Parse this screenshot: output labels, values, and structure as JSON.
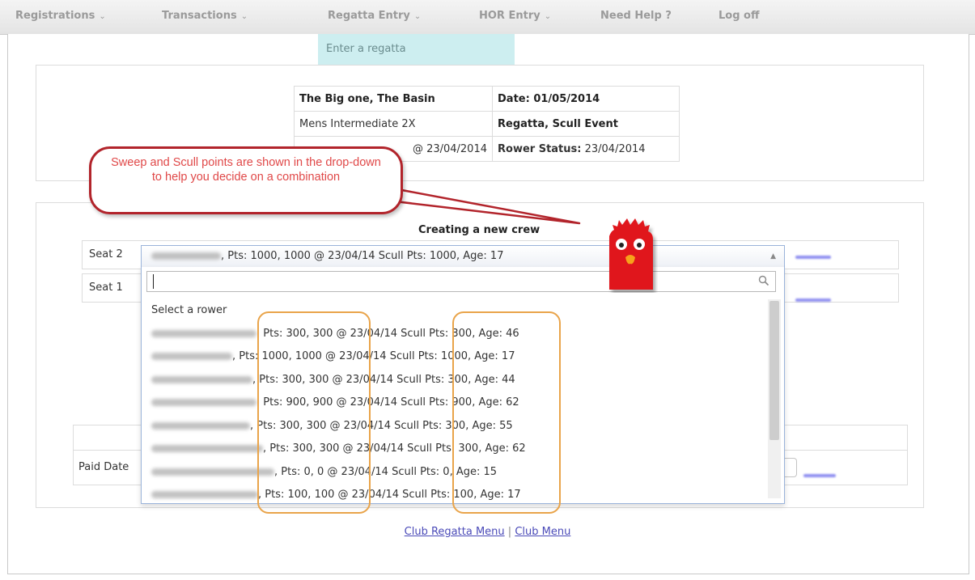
{
  "menu": {
    "items": [
      {
        "label": "Registrations",
        "caret": "⌄"
      },
      {
        "label": "Transactions",
        "caret": "⌄"
      },
      {
        "label": "Regatta Entry",
        "caret": "⌄"
      },
      {
        "label": "HOR Entry",
        "caret": "⌄"
      },
      {
        "label": "Need Help ?",
        "caret": ""
      },
      {
        "label": "Log off",
        "caret": ""
      }
    ],
    "open_submenu_item": "Enter a regatta"
  },
  "event": {
    "name": "The Big one, The Basin",
    "date": "Date: 01/05/2014",
    "category": "Mens Intermediate 2X",
    "type": "Regatta, Scull Event",
    "points_date": "@ 23/04/2014",
    "rower_status_label": "Rower Status:",
    "rower_status_value": " 23/04/2014"
  },
  "callout": {
    "text": "Sweep and Scull points are shown in the drop-down to help you decide on a combination"
  },
  "crew": {
    "heading": "Creating a new crew",
    "seats": [
      {
        "label": "Seat 2"
      },
      {
        "label": "Seat 1"
      }
    ],
    "selected_value": ", Pts: 1000, 1000 @ 23/04/14 Scull Pts: 1000, Age: 17",
    "select_arrow": "▲"
  },
  "dropdown": {
    "search_value": "",
    "options": [
      "Select a rower",
      ", Pts: 300, 300 @ 23/04/14 Scull Pts: 300, Age: 46",
      ", Pts: 1000, 1000 @ 23/04/14 Scull Pts: 1000, Age: 17",
      ", Pts: 300, 300 @ 23/04/14 Scull Pts: 300, Age: 44",
      ", Pts: 900, 900 @ 23/04/14 Scull Pts: 900, Age: 62",
      ", Pts: 300, 300 @ 23/04/14 Scull Pts: 300, Age: 55",
      ", Pts: 300, 300 @ 23/04/14 Scull Pts: 300, Age: 62",
      ", Pts: 0, 0 @ 23/04/14 Scull Pts: 0, Age: 15",
      ", Pts: 100, 100 @ 23/04/14 Scull Pts: 100, Age: 17"
    ]
  },
  "payment": {
    "paid_date_label": "Paid Date"
  },
  "footer": {
    "club_regatta_menu": "Club Regatta Menu",
    "separator": "|",
    "club_menu": "Club Menu"
  },
  "colors": {
    "callout_border": "#b2242b",
    "callout_text": "#e04848",
    "highlight": "#e9a44a",
    "submenu_bg": "#cdeef0",
    "mascot": "#e0141c"
  }
}
